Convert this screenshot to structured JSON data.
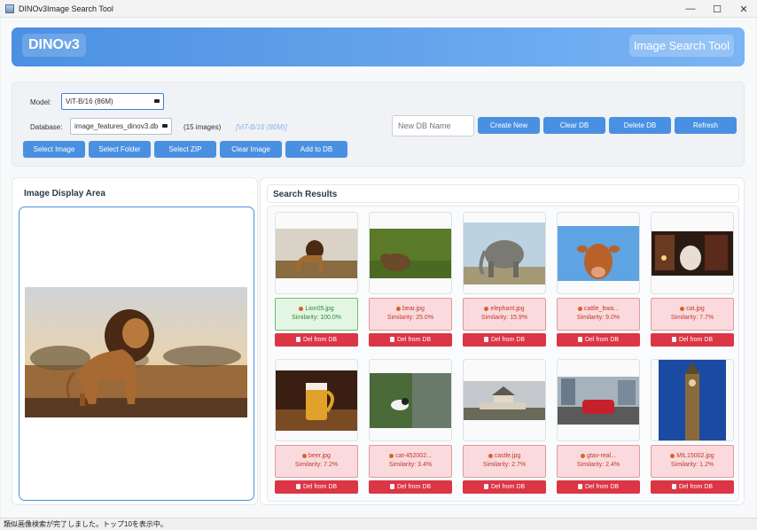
{
  "window": {
    "title": "DINOv3Image Search Tool",
    "minimize": "—",
    "maximize": "☐",
    "close": "✕"
  },
  "header": {
    "brand": "DINOv3",
    "tool_title": "Image Search Tool",
    "color_start": "#4b90e2",
    "color_end": "#7ab4f4"
  },
  "controls": {
    "model_label": "Model:",
    "model_value": "ViT-B/16 (86M)",
    "database_label": "Database:",
    "database_value": "image_features_dinov3.db",
    "image_count": "(15 images)",
    "model_info": "[ViT-B/16 (86M)]",
    "db_name_placeholder": "New DB Name",
    "create_new": "Create New",
    "clear_db": "Clear DB",
    "delete_db": "Delete DB",
    "refresh": "Refresh",
    "select_image": "Select Image",
    "select_folder": "Select Folder",
    "select_zip": "Select ZIP",
    "clear_image": "Clear Image",
    "add_to_db": "Add to DB"
  },
  "display": {
    "title": "Image Display Area"
  },
  "results": {
    "title": "Search Results",
    "delete_label": "Del from DB",
    "items": [
      {
        "file": "Lion05.jpg",
        "similarity": "Similarity: 100.0%",
        "best": true,
        "scene": "lion"
      },
      {
        "file": "bear.jpg",
        "similarity": "Similarity: 25.0%",
        "best": false,
        "scene": "bear"
      },
      {
        "file": "elephant.jpg",
        "similarity": "Similarity: 15.9%",
        "best": false,
        "scene": "elephant"
      },
      {
        "file": "cattle_bwa...",
        "similarity": "Similarity: 9.0%",
        "best": false,
        "scene": "cow"
      },
      {
        "file": "cat.jpg",
        "similarity": "Similarity: 7.7%",
        "best": false,
        "scene": "cat"
      },
      {
        "file": "beer.jpg",
        "similarity": "Similarity: 7.2%",
        "best": false,
        "scene": "beer"
      },
      {
        "file": "cat-452002...",
        "similarity": "Similarity: 3.4%",
        "best": false,
        "scene": "bird"
      },
      {
        "file": "castle.jpg",
        "similarity": "Similarity: 2.7%",
        "best": false,
        "scene": "castle"
      },
      {
        "file": "gtav-real...",
        "similarity": "Similarity: 2.4%",
        "best": false,
        "scene": "car"
      },
      {
        "file": "MIL15002.jpg",
        "similarity": "Similarity: 1.2%",
        "best": false,
        "scene": "tower"
      }
    ]
  },
  "status": {
    "text": "類似画像検索が完了しました。トップ10を表示中。"
  }
}
